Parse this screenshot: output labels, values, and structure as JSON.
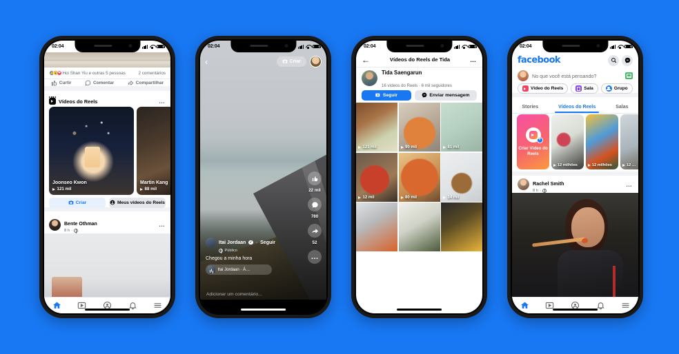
{
  "background_color": "#1877F2",
  "phones": [
    {
      "id": "feed-with-reels-tray",
      "status_bar": {
        "time": "02:04"
      },
      "post_reactions": {
        "names": "Hoi Shan Yiu e outras 5 pessoas",
        "comments": "2 comentários"
      },
      "post_actions": [
        {
          "label": "Curtir",
          "icon": "thumbs-up-icon"
        },
        {
          "label": "Comentar",
          "icon": "comment-icon"
        },
        {
          "label": "Compartilhar",
          "icon": "share-icon"
        }
      ],
      "reels_section": {
        "title": "Vídeos do Reels",
        "icon": "reels-icon",
        "overflow": "…",
        "cards": [
          {
            "author": "Joonseo Kwon",
            "views": "121 mil",
            "play_icon": "play-icon"
          },
          {
            "author": "Martin Kang",
            "views": "88 mil",
            "play_icon": "play-icon"
          }
        ],
        "buttons": [
          {
            "label": "Criar",
            "icon": "camera-icon",
            "style": "primary-soft"
          },
          {
            "label": "Meus vídeos do Reels",
            "icon": "person-icon",
            "style": "neutral"
          }
        ]
      },
      "next_post": {
        "author": "Bente Othman",
        "time": "8 h",
        "privacy_icon": "globe-icon",
        "overflow": "…"
      },
      "bottom_nav": [
        {
          "name": "home",
          "icon": "home-icon",
          "active": true
        },
        {
          "name": "watch",
          "icon": "video-icon",
          "active": false
        },
        {
          "name": "groups",
          "icon": "groups-icon",
          "active": false
        },
        {
          "name": "notifications",
          "icon": "bell-icon",
          "active": false
        },
        {
          "name": "menu",
          "icon": "hamburger-icon",
          "active": false
        }
      ]
    },
    {
      "id": "reels-player",
      "status_bar": {
        "time": "02:04"
      },
      "top_bar": {
        "back_icon": "chevron-left-icon",
        "create_label": "Criar",
        "create_icon": "camera-icon",
        "avatar": "user-avatar"
      },
      "rail": [
        {
          "icon": "thumbs-up-icon",
          "count": "22 mil"
        },
        {
          "icon": "comment-icon",
          "count": "780"
        },
        {
          "icon": "share-icon",
          "count": "52"
        },
        {
          "icon": "more-icon",
          "count": ""
        }
      ],
      "author": {
        "name": "Itai Jordaan",
        "verified": "✓",
        "separator": "·",
        "follow_label": "Seguir",
        "privacy": "Público"
      },
      "caption": "Chegou a minha hora",
      "audio": {
        "label": "Itai Jordaan · Á…",
        "icon": "audio-icon"
      },
      "comment_placeholder": "Adicionar um comentário..."
    },
    {
      "id": "reels-profile-grid",
      "status_bar": {
        "time": "02:04"
      },
      "header": {
        "back_icon": "arrow-left-icon",
        "title": "Vídeos do Reels de Tida",
        "overflow": "…"
      },
      "profile": {
        "name": "Tida Saengarun",
        "meta": "16 vídeos do Reels · 6 mil seguidores",
        "follow_label": "Seguir",
        "follow_icon": "add-friend-icon",
        "message_label": "Enviar mensagem",
        "message_icon": "messenger-icon"
      },
      "grid": [
        {
          "views": "121 mil"
        },
        {
          "views": "90 mil"
        },
        {
          "views": "81 mil"
        },
        {
          "views": "12 mil"
        },
        {
          "views": "80 mil"
        },
        {
          "views": "14 mil"
        },
        {
          "views": ""
        },
        {
          "views": ""
        },
        {
          "views": ""
        }
      ]
    },
    {
      "id": "facebook-home",
      "status_bar": {
        "time": "02:04"
      },
      "header": {
        "logo": "facebook",
        "search_icon": "search-icon",
        "messenger_icon": "messenger-icon"
      },
      "composer": {
        "placeholder": "No que você está pensando?",
        "photo_icon": "photo-icon"
      },
      "quick_pills": [
        {
          "label": "Vídeo do Reels",
          "icon": "reels-icon"
        },
        {
          "label": "Sala",
          "icon": "room-icon"
        },
        {
          "label": "Grupo",
          "icon": "group-icon"
        }
      ],
      "tabs": [
        {
          "label": "Stories",
          "active": false
        },
        {
          "label": "Vídeos do Reels",
          "active": true
        },
        {
          "label": "Salas",
          "active": false
        }
      ],
      "carousel": {
        "create_card": {
          "label": "Criar Vídeo do Reels",
          "icon": "reels-icon",
          "plus_icon": "plus-icon"
        },
        "cards": [
          {
            "views": "12 milhões"
          },
          {
            "views": "12 milhões"
          },
          {
            "views": "12 …"
          }
        ]
      },
      "post": {
        "author": "Rachel Smith",
        "time": "8 h",
        "privacy_icon": "globe-icon",
        "overflow": "…"
      },
      "bottom_nav": [
        {
          "name": "home",
          "icon": "home-icon",
          "active": true
        },
        {
          "name": "watch",
          "icon": "video-icon",
          "active": false
        },
        {
          "name": "groups",
          "icon": "groups-icon",
          "active": false
        },
        {
          "name": "notifications",
          "icon": "bell-icon",
          "active": false
        },
        {
          "name": "menu",
          "icon": "hamburger-icon",
          "active": false
        }
      ]
    }
  ]
}
